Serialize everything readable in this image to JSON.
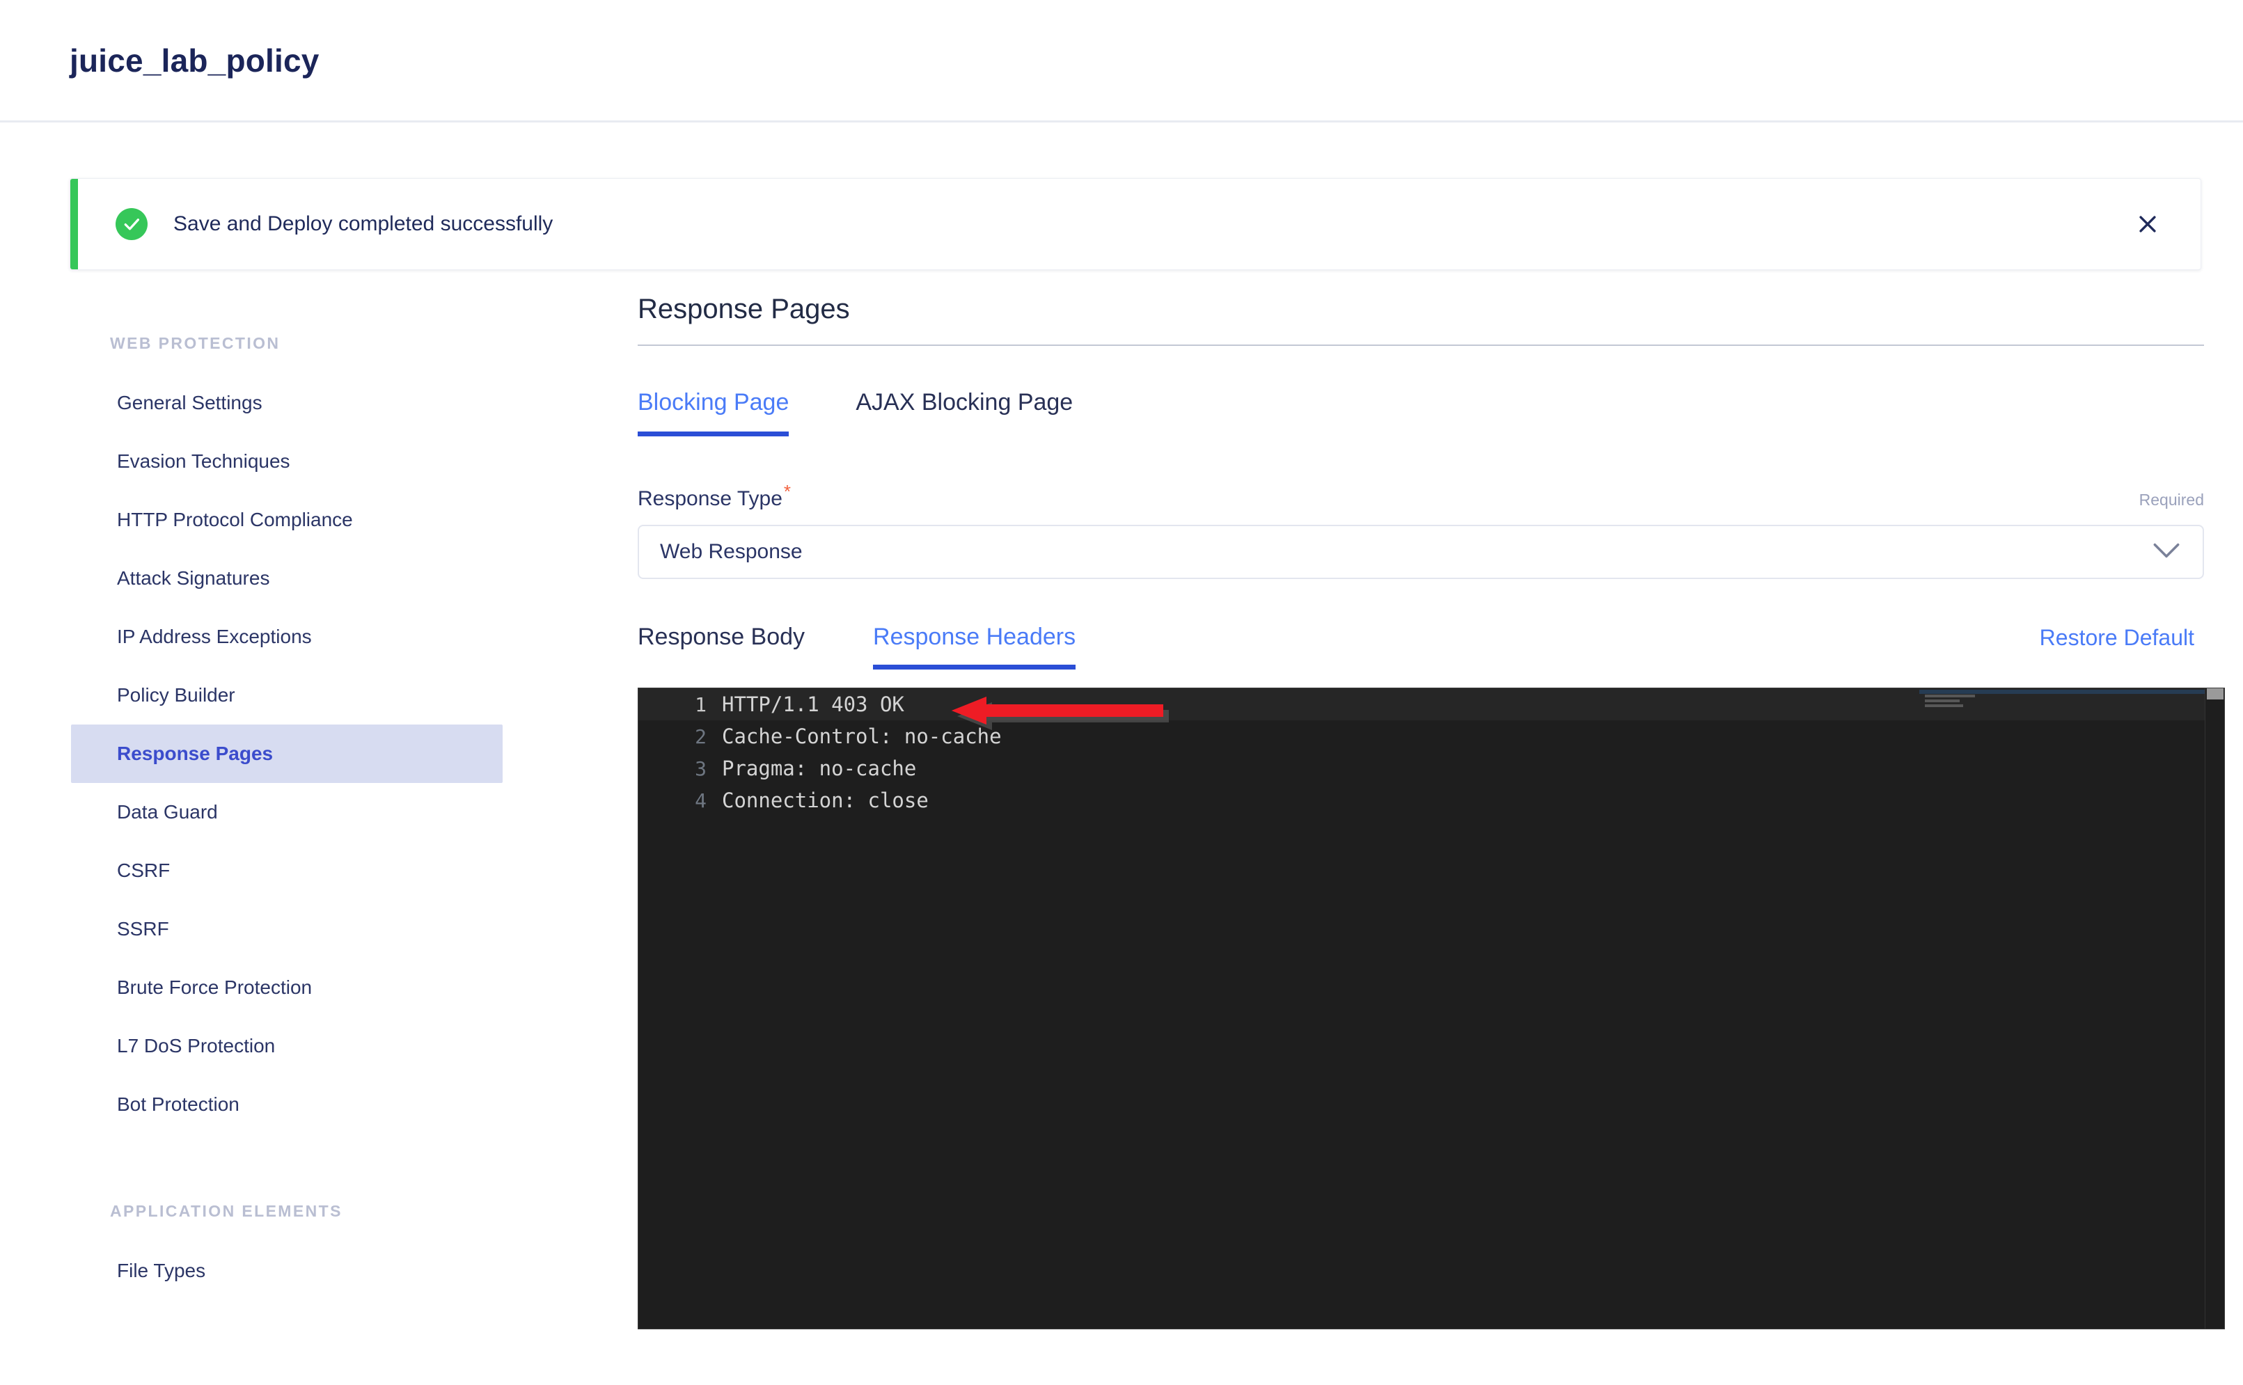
{
  "header": {
    "title": "juice_lab_policy"
  },
  "banner": {
    "message": "Save and Deploy completed successfully",
    "icon": "check-circle-icon",
    "close_icon": "close-icon",
    "accent_color": "#36c759",
    "status": "success"
  },
  "sidebar": {
    "sections": [
      {
        "title": "WEB PROTECTION",
        "items": [
          {
            "label": "General Settings",
            "active": false
          },
          {
            "label": "Evasion Techniques",
            "active": false
          },
          {
            "label": "HTTP Protocol Compliance",
            "active": false
          },
          {
            "label": "Attack Signatures",
            "active": false
          },
          {
            "label": "IP Address Exceptions",
            "active": false
          },
          {
            "label": "Policy Builder",
            "active": false
          },
          {
            "label": "Response Pages",
            "active": true
          },
          {
            "label": "Data Guard",
            "active": false
          },
          {
            "label": "CSRF",
            "active": false
          },
          {
            "label": "SSRF",
            "active": false
          },
          {
            "label": "Brute Force Protection",
            "active": false
          },
          {
            "label": "L7 DoS Protection",
            "active": false
          },
          {
            "label": "Bot Protection",
            "active": false
          }
        ]
      },
      {
        "title": "APPLICATION ELEMENTS",
        "items": [
          {
            "label": "File Types",
            "active": false
          }
        ]
      }
    ],
    "active_color": "#3b4ccc",
    "active_bg": "#d7dcf1"
  },
  "main": {
    "page_title": "Response Pages",
    "tabs": [
      {
        "label": "Blocking Page",
        "active": true
      },
      {
        "label": "AJAX Blocking Page",
        "active": false
      }
    ],
    "response_type": {
      "label": "Response Type",
      "required_marker": "*",
      "required_hint": "Required",
      "value": "Web Response",
      "chevron_icon": "chevron-down-icon",
      "options": [
        "Web Response"
      ]
    },
    "sub_tabs": [
      {
        "label": "Response Body",
        "active": false
      },
      {
        "label": "Response Headers",
        "active": true
      }
    ],
    "restore_default": "Restore Default",
    "editor": {
      "lines": [
        {
          "number": "1",
          "text": "HTTP/1.1 403 OK",
          "active": true
        },
        {
          "number": "2",
          "text": "Cache-Control: no-cache",
          "active": false
        },
        {
          "number": "3",
          "text": "Pragma: no-cache",
          "active": false
        },
        {
          "number": "4",
          "text": "Connection: close",
          "active": false
        }
      ],
      "background": "#1e1e1e",
      "annotation": {
        "type": "arrow",
        "color": "#ee1c25",
        "points_to": "HTTP/1.1 403 OK",
        "direction": "left"
      }
    }
  }
}
